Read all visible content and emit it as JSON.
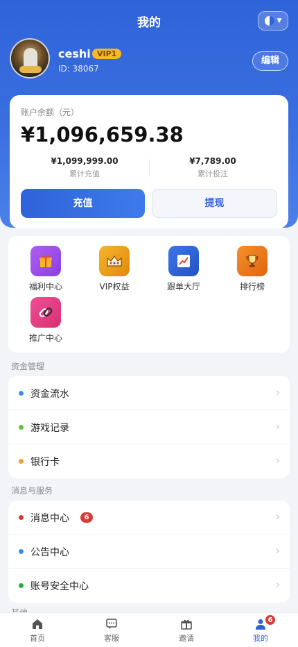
{
  "header": {
    "title": "我的"
  },
  "user": {
    "name": "ceshi",
    "vip": "VIP1",
    "id": "ID: 38067",
    "edit_label": "编辑"
  },
  "balance": {
    "label": "账户余额（元）",
    "amount": "¥1,096,659.38",
    "total_recharge_value": "¥1,099,999.00",
    "total_recharge_label": "累计充值",
    "total_bet_value": "¥7,789.00",
    "total_bet_label": "累计投注",
    "recharge_button": "充值",
    "withdraw_button": "提现"
  },
  "grid": [
    {
      "label": "福利中心",
      "icon": "gift-icon",
      "color": "#9b4de8"
    },
    {
      "label": "VIP权益",
      "icon": "crown-icon",
      "color": "#f0a21a"
    },
    {
      "label": "跟单大厅",
      "icon": "chart-icon",
      "color": "#2f63d9"
    },
    {
      "label": "排行榜",
      "icon": "trophy-icon",
      "color": "#f27c12"
    },
    {
      "label": "推广中心",
      "icon": "link-icon",
      "color": "#e8418c"
    }
  ],
  "fund_section": {
    "title": "资金管理",
    "items": [
      {
        "label": "资金流水",
        "dot_color": "#3b8de8"
      },
      {
        "label": "游戏记录",
        "dot_color": "#5cc53b"
      },
      {
        "label": "银行卡",
        "dot_color": "#e8a23b"
      }
    ]
  },
  "message_section": {
    "title": "消息与服务",
    "items": [
      {
        "label": "消息中心",
        "badge": "6",
        "dot_color": "#d83a34"
      },
      {
        "label": "公告中心",
        "dot_color": "#3b8de8"
      },
      {
        "label": "账号安全中心",
        "dot_color": "#2aa84a"
      }
    ]
  },
  "other_section": {
    "title": "其他"
  },
  "tabbar": {
    "tabs": [
      {
        "label": "首页",
        "icon": "home-icon"
      },
      {
        "label": "客服",
        "icon": "chat-icon"
      },
      {
        "label": "邀请",
        "icon": "gift-box-icon"
      },
      {
        "label": "我的",
        "icon": "user-icon",
        "badge": "6",
        "active": true
      }
    ]
  }
}
